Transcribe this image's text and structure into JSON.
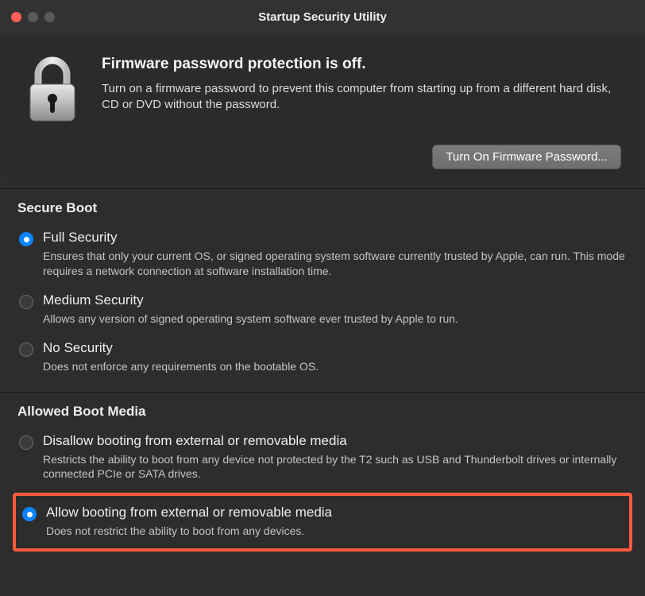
{
  "window_title": "Startup Security Utility",
  "firmware": {
    "heading": "Firmware password protection is off.",
    "description": "Turn on a firmware password to prevent this computer from starting up from a different hard disk, CD or DVD without the password.",
    "button_label": "Turn On Firmware Password..."
  },
  "secure_boot": {
    "heading": "Secure Boot",
    "options": [
      {
        "label": "Full Security",
        "description": "Ensures that only your current OS, or signed operating system software currently trusted by Apple, can run. This mode requires a network connection at software installation time.",
        "selected": true
      },
      {
        "label": "Medium Security",
        "description": "Allows any version of signed operating system software ever trusted by Apple to run.",
        "selected": false
      },
      {
        "label": "No Security",
        "description": "Does not enforce any requirements on the bootable OS.",
        "selected": false
      }
    ]
  },
  "boot_media": {
    "heading": "Allowed Boot Media",
    "options": [
      {
        "label": "Disallow booting from external or removable media",
        "description": "Restricts the ability to boot from any device not protected by the T2 such as USB and Thunderbolt drives or internally connected PCIe or SATA drives.",
        "selected": false
      },
      {
        "label": "Allow booting from external or removable media",
        "description": "Does not restrict the ability to boot from any devices.",
        "selected": true
      }
    ]
  }
}
